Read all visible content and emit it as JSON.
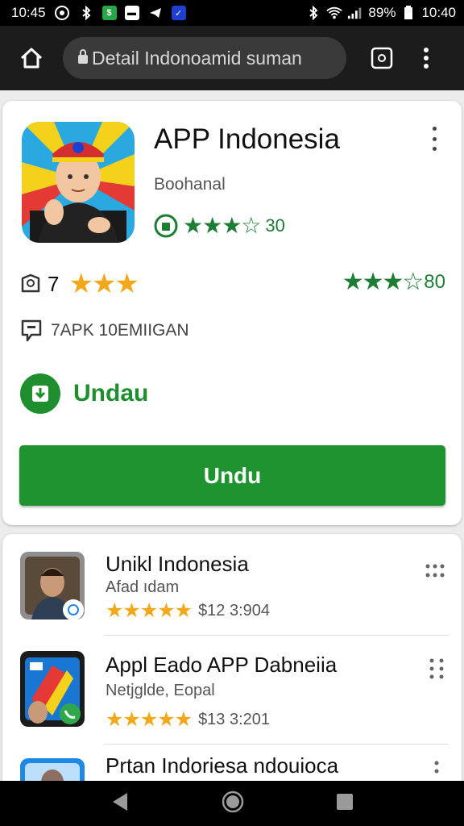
{
  "status_bar": {
    "time_left": "10:45",
    "battery": "89%",
    "time_right": "10:40"
  },
  "toolbar": {
    "url": "Detail Indonoamid suman"
  },
  "app": {
    "title": "APP Indonesia",
    "developer": "Boohanal",
    "rating_stars": "★★★☆",
    "rating_value": "30",
    "meta_left_label": "7",
    "meta_left_stars": "★★★",
    "meta_right_stars": "★★★☆",
    "meta_right_value": "80",
    "info_text": "7APK 10EMIIGAN",
    "download_label": "Undau",
    "install_label": "Undu"
  },
  "list": [
    {
      "title": "Unikl Indonesia",
      "subtitle": "Afad ıdam",
      "stars": "★★★★★",
      "price": "$12 3:904"
    },
    {
      "title": "Appl Eado APP Dabneiia",
      "subtitle": "Netjglde, Eopal",
      "stars": "★★★★★",
      "price": "$13 3:201"
    },
    {
      "title": "Prtan Indoriesa ndouioca",
      "subtitle": "",
      "stars": "",
      "price": ""
    }
  ],
  "colors": {
    "accent_green": "#1e9330",
    "star_orange": "#f2a81a",
    "star_green": "#1e7d34"
  }
}
